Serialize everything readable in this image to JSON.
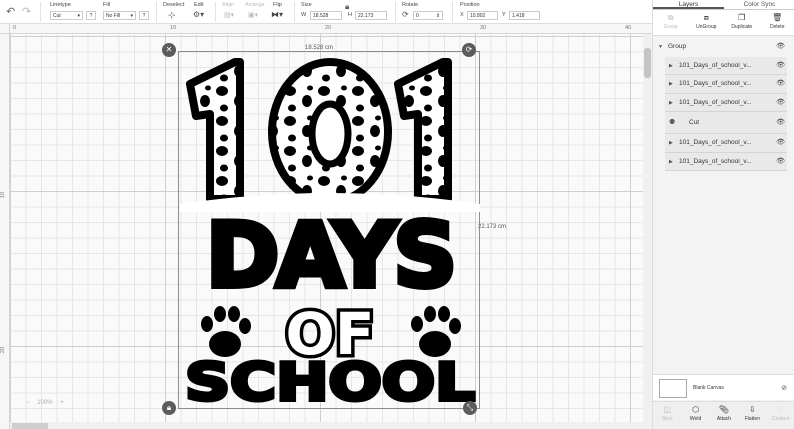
{
  "toolbar": {
    "undo_icon": "undo-icon",
    "linetype": {
      "label": "Linetype",
      "value": "Cut"
    },
    "fill": {
      "label": "Fill",
      "value": "No Fill",
      "help": "?"
    },
    "help_q": "?",
    "deselect": "Deselect",
    "edit": "Edit",
    "align": "Align",
    "arrange": "Arrange",
    "flip": "Flip",
    "size": {
      "label": "Size",
      "w_label": "W",
      "w_value": "18.528",
      "h_label": "H",
      "h_value": "22.173"
    },
    "rotate": {
      "label": "Rotate",
      "value": "0"
    },
    "position": {
      "label": "Position",
      "x_label": "X",
      "x_value": "10.802",
      "y_label": "Y",
      "y_value": "1.418"
    }
  },
  "ruler": {
    "top": [
      "0",
      "10",
      "20",
      "30",
      "40"
    ],
    "left": [
      "10",
      "20"
    ]
  },
  "canvas": {
    "width_label": "18.528 cm",
    "height_label": "22.173 cm",
    "design": {
      "line1": "101",
      "line2": "DAYS",
      "line3": "OF",
      "line4": "SCHOOL"
    },
    "zoom_minus": "−",
    "zoom_value": "100%",
    "zoom_plus": "+"
  },
  "panel": {
    "tabs": [
      {
        "label": "Layers",
        "active": true
      },
      {
        "label": "Color Sync",
        "active": false
      }
    ],
    "actions": [
      {
        "label": "Group",
        "icon": "group-icon",
        "enabled": false
      },
      {
        "label": "UnGroup",
        "icon": "ungroup-icon",
        "enabled": true
      },
      {
        "label": "Duplicate",
        "icon": "duplicate-icon",
        "enabled": true
      },
      {
        "label": "Delete",
        "icon": "trash-icon",
        "enabled": true
      }
    ],
    "group_label": "Group",
    "layers": [
      {
        "name": "101_Days_of_school_v..."
      },
      {
        "name": "101_Days_of_school_v..."
      },
      {
        "name": "101_Days_of_school_v..."
      },
      {
        "name": "Cut"
      },
      {
        "name": "101_Days_of_school_v..."
      },
      {
        "name": "101_Days_of_school_v..."
      }
    ],
    "blank_canvas": "Blank Canvas",
    "bottom_actions": [
      {
        "label": "Slice",
        "icon": "slice-icon",
        "enabled": false
      },
      {
        "label": "Weld",
        "icon": "weld-icon",
        "enabled": true
      },
      {
        "label": "Attach",
        "icon": "attach-icon",
        "enabled": true
      },
      {
        "label": "Flatten",
        "icon": "flatten-icon",
        "enabled": true
      },
      {
        "label": "Contour",
        "icon": "contour-icon",
        "enabled": false
      }
    ]
  }
}
